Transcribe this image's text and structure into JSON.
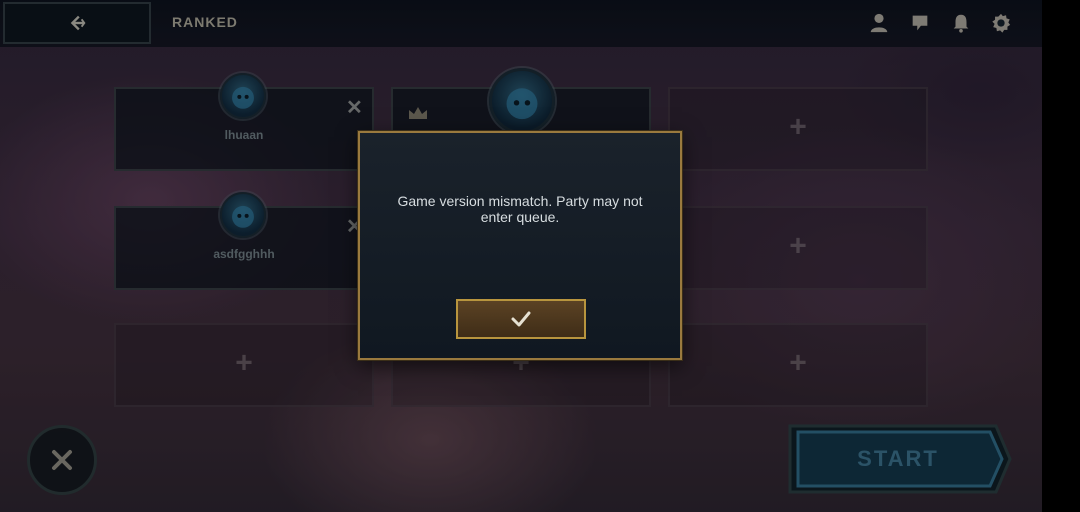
{
  "header": {
    "mode_title": "RANKED",
    "icons": [
      "back-arrow-icon",
      "profile-icon",
      "store-icon",
      "notification-bell-icon",
      "settings-gear-icon"
    ]
  },
  "party": {
    "slots": [
      {
        "state": "member",
        "name": "lhuaan",
        "kickable": true
      },
      {
        "state": "leader",
        "name": "",
        "crown": true
      },
      {
        "state": "empty"
      },
      {
        "state": "member",
        "name": "asdfgghhh",
        "kickable": true
      },
      {
        "state": "empty"
      },
      {
        "state": "empty"
      },
      {
        "state": "empty"
      },
      {
        "state": "empty"
      },
      {
        "state": "empty"
      }
    ],
    "add_symbol": "+",
    "kick_symbol": "✕"
  },
  "dialog": {
    "message": "Game version mismatch. Party may not enter queue.",
    "confirm_icon": "checkmark-icon"
  },
  "footer": {
    "leave_icon": "close-icon",
    "start_label": "START"
  },
  "colors": {
    "gold_border": "#9a7a3e",
    "start_blue": "#3a6f8a"
  }
}
